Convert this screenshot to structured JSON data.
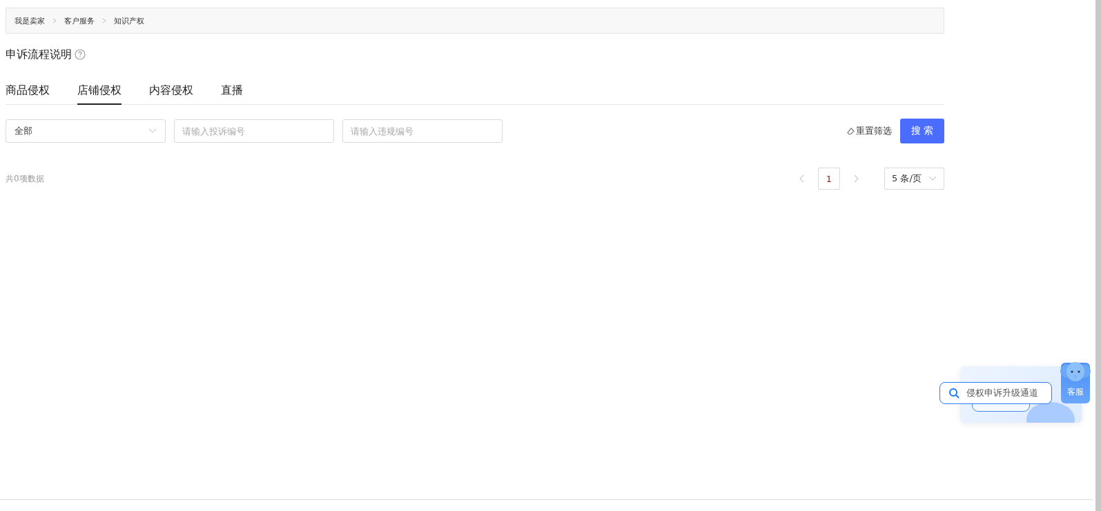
{
  "breadcrumb": [
    {
      "label": "我是卖家"
    },
    {
      "label": "客户服务"
    },
    {
      "label": "知识产权"
    }
  ],
  "heading": {
    "title": "申诉流程说明"
  },
  "tabs": [
    {
      "label": "商品侵权",
      "selected": false
    },
    {
      "label": "店铺侵权",
      "selected": true
    },
    {
      "label": "内容侵权",
      "selected": false
    },
    {
      "label": "直播",
      "selected": false
    }
  ],
  "filters": {
    "category": {
      "value": "全部"
    },
    "complaint_no": {
      "placeholder": "请输入投诉编号"
    },
    "violation_no": {
      "placeholder": "请输入违规编号"
    },
    "reset": "重置筛选",
    "search": "搜 索"
  },
  "total": "共0项数据",
  "pagination": {
    "prev_disabled": true,
    "pages": [
      {
        "label": "1",
        "selected": true
      }
    ],
    "page_size": "5 条/页"
  },
  "floating": {
    "search_pill": "侵权申诉升级通道",
    "service": "客服"
  }
}
